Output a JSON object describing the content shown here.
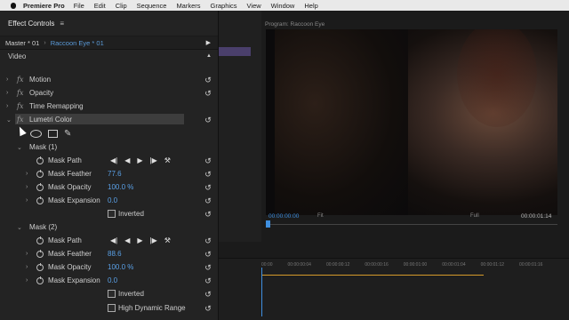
{
  "menubar": {
    "app": "Premiere Pro",
    "items": [
      "File",
      "Edit",
      "Clip",
      "Sequence",
      "Markers",
      "Graphics",
      "View",
      "Window",
      "Help"
    ]
  },
  "panel": {
    "title": "Effect Controls",
    "master_label": "Master * 01",
    "clip_label": "Raccoon Eye * 01",
    "section": "Video",
    "effects": [
      "Motion",
      "Opacity",
      "Time Remapping",
      "Lumetri Color"
    ]
  },
  "mask1": {
    "title": "Mask (1)",
    "path_label": "Mask Path",
    "feather_label": "Mask Feather",
    "feather_value": "77.6",
    "opacity_label": "Mask Opacity",
    "opacity_value": "100.0 %",
    "expansion_label": "Mask Expansion",
    "expansion_value": "0.0",
    "inverted_label": "Inverted"
  },
  "mask2": {
    "title": "Mask (2)",
    "path_label": "Mask Path",
    "feather_label": "Mask Feather",
    "feather_value": "88.6",
    "opacity_label": "Mask Opacity",
    "opacity_value": "100.0 %",
    "expansion_label": "Mask Expansion",
    "expansion_value": "0.0",
    "inverted_label": "Inverted",
    "hdr_label": "High Dynamic Range"
  },
  "monitor": {
    "title": "Program: Raccoon Eye",
    "timecode": "00:00:00:00",
    "fit": "Fit",
    "quality": "Full",
    "duration": "00:00:01:14"
  },
  "timeline": {
    "ruler": [
      "00:00",
      "00:00:00:04",
      "00:00:00:12",
      "00:00:00:16",
      "00:00:01:00",
      "00:00:01:04",
      "00:00:01:12",
      "00:00:01:16"
    ]
  }
}
